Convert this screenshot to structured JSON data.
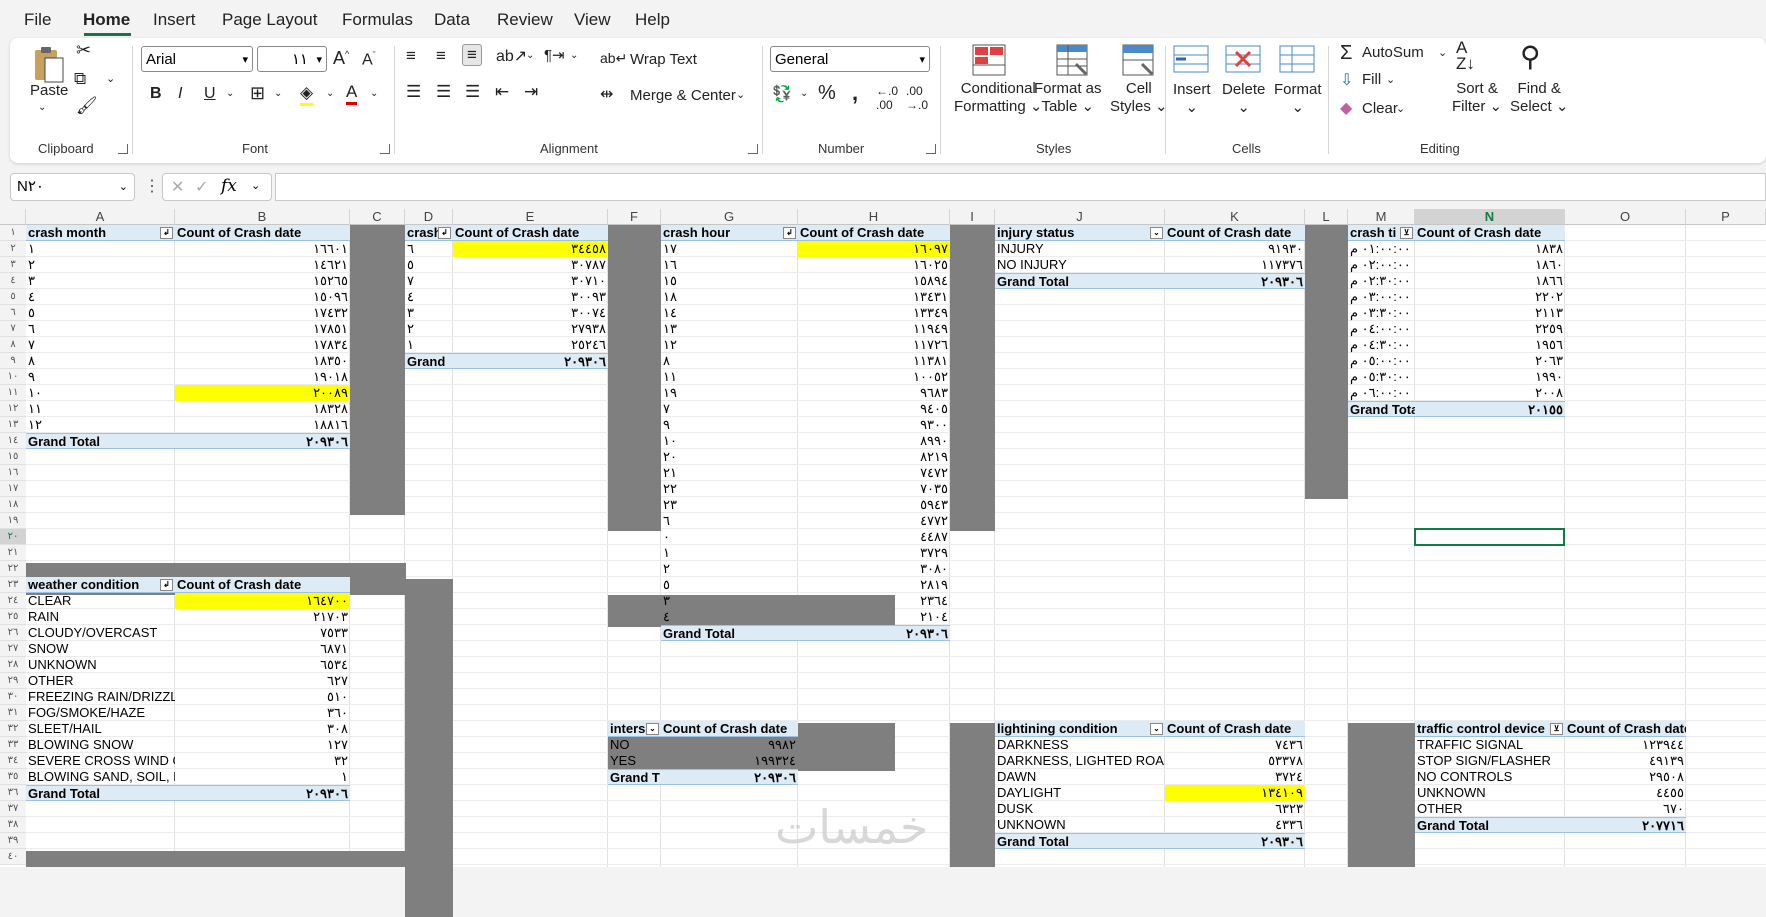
{
  "menu": [
    "File",
    "Home",
    "Insert",
    "Page Layout",
    "Formulas",
    "Data",
    "Review",
    "View",
    "Help"
  ],
  "ribbon": {
    "clipboard": {
      "paste": "Paste",
      "label": "Clipboard"
    },
    "font": {
      "name": "Arial",
      "size": "١١",
      "label": "Font"
    },
    "alignment": {
      "wrap": "Wrap Text",
      "merge": "Merge & Center",
      "label": "Alignment"
    },
    "number": {
      "format": "General",
      "label": "Number"
    },
    "styles": {
      "cond1": "Conditional",
      "cond2": "Formatting",
      "fmt1": "Format as",
      "fmt2": "Table",
      "cell1": "Cell",
      "cell2": "Styles",
      "label": "Styles"
    },
    "cells": {
      "insert": "Insert",
      "delete": "Delete",
      "format": "Format",
      "label": "Cells"
    },
    "editing": {
      "autosum": "AutoSum",
      "fill": "Fill",
      "clear": "Clear",
      "sort1": "Sort &",
      "sort2": "Filter",
      "find1": "Find &",
      "find2": "Select",
      "label": "Editing"
    }
  },
  "namebox": "N٢٠",
  "columns": [
    "A",
    "B",
    "C",
    "D",
    "E",
    "F",
    "G",
    "H",
    "I",
    "J",
    "K",
    "L",
    "M",
    "N",
    "O",
    "P"
  ],
  "rows": [
    "١",
    "٢",
    "٣",
    "٤",
    "٥",
    "٦",
    "٧",
    "٨",
    "٩",
    "١٠",
    "١١",
    "١٢",
    "١٣",
    "١٤",
    "١٥",
    "١٦",
    "١٧",
    "١٨",
    "١٩",
    "٢٠",
    "٢١",
    "٢٢",
    "٢٣",
    "٢٤",
    "٢٥",
    "٢٦",
    "٢٧",
    "٢٨",
    "٢٩",
    "٣٠",
    "٣١",
    "٣٢",
    "٣٣",
    "٣٤",
    "٣٥",
    "٣٦",
    "٣٧",
    "٣٨",
    "٣٩",
    "٤٠"
  ],
  "pt_month": {
    "h1": "crash month",
    "h2": "Count of Crash date",
    "rows": [
      [
        "١",
        "١٦٦٠١"
      ],
      [
        "٢",
        "١٤٦٢١"
      ],
      [
        "٣",
        "١٥٢٦٥"
      ],
      [
        "٤",
        "١٥٠٩٦"
      ],
      [
        "٥",
        "١٧٤٣٢"
      ],
      [
        "٦",
        "١٧٨٥١"
      ],
      [
        "٧",
        "١٧٨٣٤"
      ],
      [
        "٨",
        "١٨٣٥٠"
      ],
      [
        "٩",
        "١٩٠١٨"
      ],
      [
        "١٠",
        "٢٠٠٨٩"
      ],
      [
        "١١",
        "١٨٣٢٨"
      ],
      [
        "١٢",
        "١٨٨١٦"
      ]
    ],
    "total": "Grand Total",
    "total_val": "٢٠٩٣٠٦"
  },
  "pt_day": {
    "h1": "crash",
    "h2": "Count of Crash date",
    "rows": [
      [
        "٦",
        "٣٤٤٥٨"
      ],
      [
        "٥",
        "٣٠٧٨٧"
      ],
      [
        "٧",
        "٣٠٧١٠"
      ],
      [
        "٤",
        "٣٠٠٩٣"
      ],
      [
        "٣",
        "٣٠٠٧٤"
      ],
      [
        "٢",
        "٢٧٩٣٨"
      ],
      [
        "١",
        "٢٥٢٤٦"
      ]
    ],
    "total": "Grand",
    "total_val": "٢٠٩٣٠٦"
  },
  "pt_hour": {
    "h1": "crash hour",
    "h2": "Count of Crash date",
    "rows": [
      [
        "١٧",
        "١٦٠٩٧"
      ],
      [
        "١٦",
        "١٦٠٢٥"
      ],
      [
        "١٥",
        "١٥٨٩٤"
      ],
      [
        "١٨",
        "١٣٤٣١"
      ],
      [
        "١٤",
        "١٣٣٤٩"
      ],
      [
        "١٣",
        "١١٩٤٩"
      ],
      [
        "١٢",
        "١١٧٢٦"
      ],
      [
        "٨",
        "١١٣٨١"
      ],
      [
        "١١",
        "١٠٠٥٢"
      ],
      [
        "١٩",
        "٩٦٨٣"
      ],
      [
        "٧",
        "٩٤٠٥"
      ],
      [
        "٩",
        "٩٣٠٠"
      ],
      [
        "١٠",
        "٨٩٩٠"
      ],
      [
        "٢٠",
        "٨٢١٩"
      ],
      [
        "٢١",
        "٧٤٧٢"
      ],
      [
        "٢٢",
        "٧٠٣٥"
      ],
      [
        "٢٣",
        "٥٩٤٣"
      ],
      [
        "٦",
        "٤٧٧٢"
      ],
      [
        "٠",
        "٤٤٨٧"
      ],
      [
        "١",
        "٣٧٢٩"
      ],
      [
        "٢",
        "٣٠٨٠"
      ],
      [
        "٥",
        "٢٨١٩"
      ],
      [
        "٣",
        "٢٣٦٤"
      ],
      [
        "٤",
        "٢١٠٤"
      ]
    ],
    "total": "Grand Total",
    "total_val": "٢٠٩٣٠٦"
  },
  "pt_injury": {
    "h1": "injury status",
    "h2": "Count of Crash date",
    "rows": [
      [
        "INJURY",
        "٩١٩٣٠"
      ],
      [
        "NO INJURY",
        "١١٧٣٧٦"
      ]
    ],
    "total": "Grand Total",
    "total_val": "٢٠٩٣٠٦"
  },
  "pt_time": {
    "h1": "crash ti",
    "h2": "Count of Crash date",
    "rows": [
      [
        "٠١:٠٠:٠٠ م",
        "١٨٣٨"
      ],
      [
        "٠٢:٠٠:٠٠ م",
        "١٨٦٠"
      ],
      [
        "٠٢:٣٠:٠٠ م",
        "١٨٦٦"
      ],
      [
        "٠٣:٠٠:٠٠ م",
        "٢٢٠٢"
      ],
      [
        "٠٣:٣٠:٠٠ م",
        "٢١١٣"
      ],
      [
        "٠٤:٠٠:٠٠ م",
        "٢٢٥٩"
      ],
      [
        "٠٤:٣٠:٠٠ م",
        "١٩٥٦"
      ],
      [
        "٠٥:٠٠:٠٠ م",
        "٢٠٦٣"
      ],
      [
        "٠٥:٣٠:٠٠ م",
        "١٩٩٠"
      ],
      [
        "٠٦:٠٠:٠٠ م",
        "٢٠٠٨"
      ]
    ],
    "total": "Grand Tota",
    "total_val": "٢٠١٥٥"
  },
  "pt_weather": {
    "h1": "weather condition",
    "h2": "Count of Crash date",
    "rows": [
      [
        "CLEAR",
        "١٦٤٧٠٠"
      ],
      [
        "RAIN",
        "٢١٧٠٣"
      ],
      [
        "CLOUDY/OVERCAST",
        "٧٥٣٣"
      ],
      [
        "SNOW",
        "٦٨٧١"
      ],
      [
        "UNKNOWN",
        "٦٥٣٤"
      ],
      [
        "OTHER",
        "٦٢٧"
      ],
      [
        "FREEZING RAIN/DRIZZLE",
        "٥١٠"
      ],
      [
        "FOG/SMOKE/HAZE",
        "٣٦٠"
      ],
      [
        "SLEET/HAIL",
        "٣٠٨"
      ],
      [
        "BLOWING SNOW",
        "١٢٧"
      ],
      [
        "SEVERE CROSS WIND GAT",
        "٣٢"
      ],
      [
        "BLOWING SAND, SOIL, DIRT",
        "١"
      ]
    ],
    "total": "Grand Total",
    "total_val": "٢٠٩٣٠٦"
  },
  "pt_inter": {
    "h1": "inters",
    "h2": "Count of Crash date",
    "rows": [
      [
        "NO",
        "٩٩٨٢"
      ],
      [
        "YES",
        "١٩٩٣٢٤"
      ]
    ],
    "total": "Grand T",
    "total_val": "٢٠٩٣٠٦"
  },
  "pt_light": {
    "h1": "lightining condition",
    "h2": "Count of Crash date",
    "rows": [
      [
        "DARKNESS",
        "٧٤٣٦"
      ],
      [
        "DARKNESS, LIGHTED ROAD",
        "٥٣٣٧٨"
      ],
      [
        "DAWN",
        "٣٧٢٤"
      ],
      [
        "DAYLIGHT",
        "١٣٤١٠٩"
      ],
      [
        "DUSK",
        "٦٣٢٣"
      ],
      [
        "UNKNOWN",
        "٤٣٣٦"
      ]
    ],
    "total": "Grand Total",
    "total_val": "٢٠٩٣٠٦"
  },
  "pt_traffic": {
    "h1": "traffic control device",
    "h2": "Count of Crash date",
    "rows": [
      [
        "TRAFFIC SIGNAL",
        "١٢٣٩٤٤"
      ],
      [
        "STOP SIGN/FLASHER",
        "٤٩١٣٩"
      ],
      [
        "NO CONTROLS",
        "٢٩٥٠٨"
      ],
      [
        "UNKNOWN",
        "٤٤٥٥"
      ],
      [
        "OTHER",
        "٦٧٠"
      ]
    ],
    "total": "Grand Total",
    "total_val": "٢٠٧٧١٦"
  },
  "watermark": "خمسات"
}
